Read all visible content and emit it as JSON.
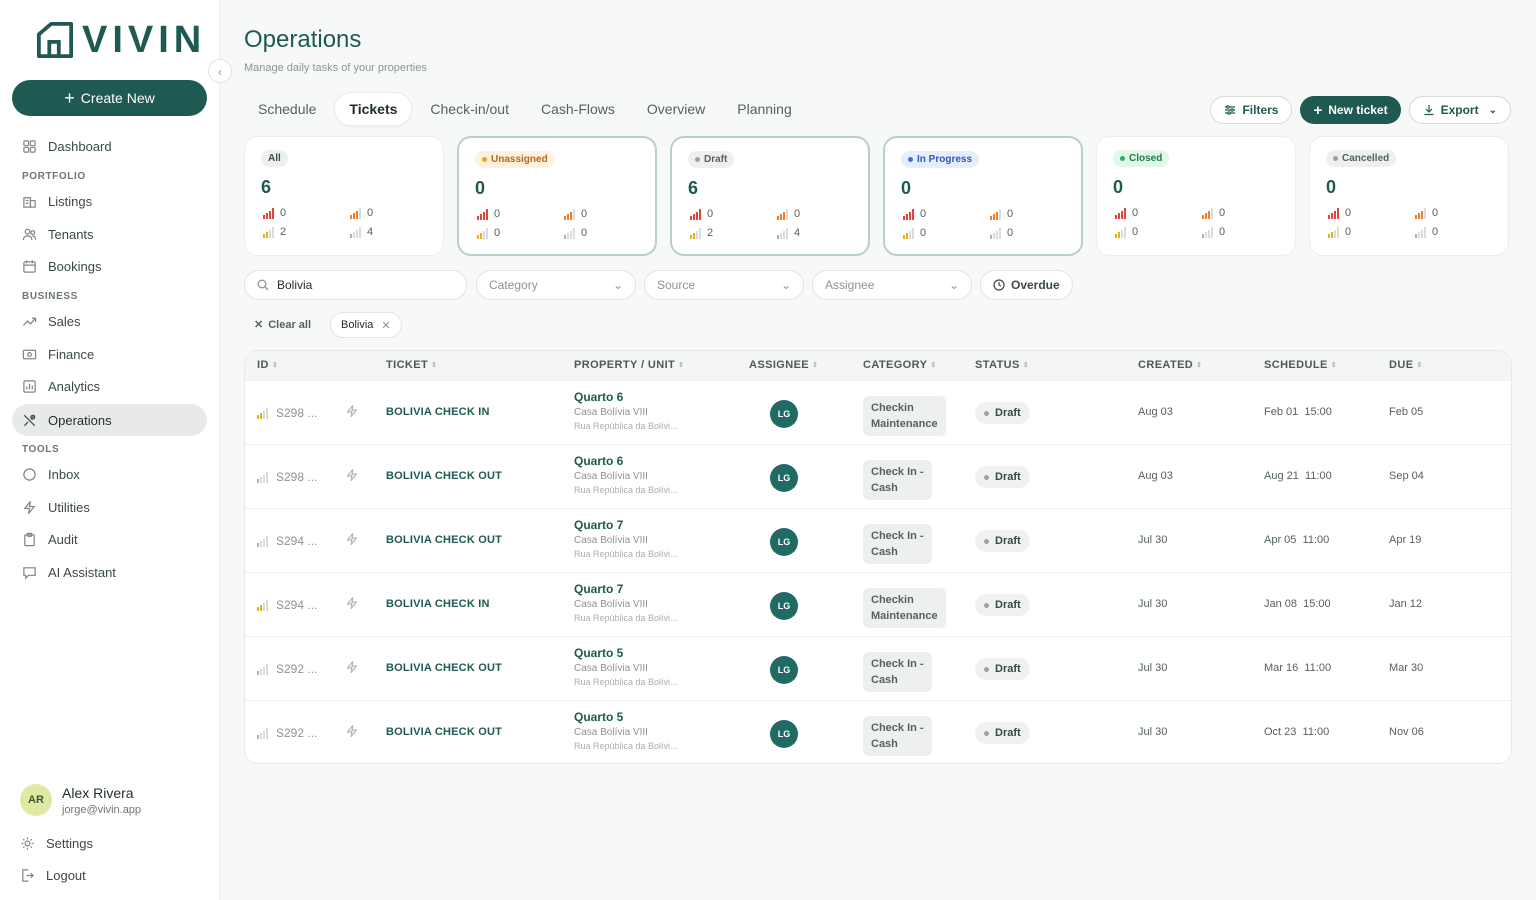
{
  "brand": {
    "name": "VIVIN",
    "accent": "#1f5a52"
  },
  "sidebar": {
    "create_label": "Create New",
    "sections": {
      "portfolio": "PORTFOLIO",
      "business": "BUSINESS",
      "tools": "TOOLS"
    },
    "items": [
      {
        "label": "Dashboard",
        "icon": "grid-icon"
      },
      {
        "label": "Listings",
        "icon": "building-icon"
      },
      {
        "label": "Tenants",
        "icon": "users-icon"
      },
      {
        "label": "Bookings",
        "icon": "calendar-icon"
      },
      {
        "label": "Sales",
        "icon": "trend-icon"
      },
      {
        "label": "Finance",
        "icon": "money-icon"
      },
      {
        "label": "Analytics",
        "icon": "chart-icon"
      },
      {
        "label": "Operations",
        "icon": "tools-icon",
        "active": true
      },
      {
        "label": "Inbox",
        "icon": "chat-icon"
      },
      {
        "label": "Utilities",
        "icon": "bolt-icon"
      },
      {
        "label": "Audit",
        "icon": "clipboard-icon"
      },
      {
        "label": "AI Assistant",
        "icon": "ai-chat-icon"
      }
    ],
    "user": {
      "initials": "AR",
      "name": "Alex Rivera",
      "email": "jorge@vivin.app"
    },
    "settings_label": "Settings",
    "logout_label": "Logout"
  },
  "header": {
    "title": "Operations",
    "subtitle": "Manage daily tasks of your properties",
    "tabs": [
      "Schedule",
      "Tickets",
      "Check-in/out",
      "Cash-Flows",
      "Overview",
      "Planning"
    ],
    "active_tab": "Tickets",
    "filters_label": "Filters",
    "new_ticket_label": "New ticket",
    "export_label": "Export"
  },
  "cards": [
    {
      "label": "All",
      "count": "6",
      "urgent": "0",
      "high": "0",
      "medium": "2",
      "low": "4",
      "dot": ""
    },
    {
      "label": "Unassigned",
      "count": "0",
      "urgent": "0",
      "high": "0",
      "medium": "0",
      "low": "0",
      "dot": "#f0a20a",
      "color": "#b9651a",
      "bg": "#fdf1df"
    },
    {
      "label": "Draft",
      "count": "6",
      "urgent": "0",
      "high": "0",
      "medium": "2",
      "low": "4",
      "dot": "#9aa3a1",
      "color": "#55625f",
      "bg": "#eef0f0"
    },
    {
      "label": "In Progress",
      "count": "0",
      "urgent": "0",
      "high": "0",
      "medium": "0",
      "low": "0",
      "dot": "#3b6fe0",
      "color": "#2f56b8",
      "bg": "#e6eefc"
    },
    {
      "label": "Closed",
      "count": "0",
      "urgent": "0",
      "high": "0",
      "medium": "0",
      "low": "0",
      "dot": "#22b45e",
      "color": "#1b7e45",
      "bg": "#e3f6ea"
    },
    {
      "label": "Cancelled",
      "count": "0",
      "urgent": "0",
      "high": "0",
      "medium": "0",
      "low": "0",
      "dot": "#9aa3a1",
      "color": "#55625f",
      "bg": "#eef0f0"
    }
  ],
  "filters": {
    "search_value": "Bolivia",
    "category_placeholder": "Category",
    "source_placeholder": "Source",
    "assignee_placeholder": "Assignee",
    "overdue_label": "Overdue",
    "clear_all_label": "Clear all",
    "active_chip": "Bolivia"
  },
  "table": {
    "columns": [
      "ID",
      "TICKET",
      "PROPERTY / UNIT",
      "ASSIGNEE",
      "CATEGORY",
      "STATUS",
      "CREATED",
      "SCHEDULE",
      "DUE"
    ],
    "rows": [
      {
        "priority": "med",
        "id": "S298 ...",
        "ticket": "BOLIVIA CHECK IN",
        "unit": "Quarto 6",
        "listing": "Casa Bolívia VIII",
        "address": "Rua República da Bolívi...",
        "assignee": "LG",
        "category_line1": "Checkin",
        "category_line2": "Maintenance",
        "status": "Draft",
        "created": "Aug 03",
        "schedule": "Feb 01  15:00",
        "due": "Feb 05"
      },
      {
        "priority": "low",
        "id": "S298 ...",
        "ticket": "BOLIVIA CHECK OUT",
        "unit": "Quarto 6",
        "listing": "Casa Bolívia VIII",
        "address": "Rua República da Bolívi...",
        "assignee": "LG",
        "category_line1": "Check In -",
        "category_line2": "Cash",
        "status": "Draft",
        "created": "Aug 03",
        "schedule": "Aug 21  11:00",
        "due": "Sep 04"
      },
      {
        "priority": "low",
        "id": "S294 ...",
        "ticket": "BOLIVIA CHECK OUT",
        "unit": "Quarto 7",
        "listing": "Casa Bolívia VIII",
        "address": "Rua República da Bolívi...",
        "assignee": "LG",
        "category_line1": "Check In -",
        "category_line2": "Cash",
        "status": "Draft",
        "created": "Jul 30",
        "schedule": "Apr 05  11:00",
        "due": "Apr 19"
      },
      {
        "priority": "med",
        "id": "S294 ...",
        "ticket": "BOLIVIA CHECK IN",
        "unit": "Quarto 7",
        "listing": "Casa Bolívia VIII",
        "address": "Rua República da Bolívi...",
        "assignee": "LG",
        "category_line1": "Checkin",
        "category_line2": "Maintenance",
        "status": "Draft",
        "created": "Jul 30",
        "schedule": "Jan 08  15:00",
        "due": "Jan 12"
      },
      {
        "priority": "low",
        "id": "S292 ...",
        "ticket": "BOLIVIA CHECK OUT",
        "unit": "Quarto 5",
        "listing": "Casa Bolívia VIII",
        "address": "Rua República da Bolívi...",
        "assignee": "LG",
        "category_line1": "Check In -",
        "category_line2": "Cash",
        "status": "Draft",
        "created": "Jul 30",
        "schedule": "Mar 16  11:00",
        "due": "Mar 30"
      },
      {
        "priority": "low",
        "id": "S292 ...",
        "ticket": "BOLIVIA CHECK OUT",
        "unit": "Quarto 5",
        "listing": "Casa Bolívia VIII",
        "address": "Rua República da Bolívi...",
        "assignee": "LG",
        "category_line1": "Check In -",
        "category_line2": "Cash",
        "status": "Draft",
        "created": "Jul 30",
        "schedule": "Oct 23  11:00",
        "due": "Nov 06"
      }
    ]
  }
}
